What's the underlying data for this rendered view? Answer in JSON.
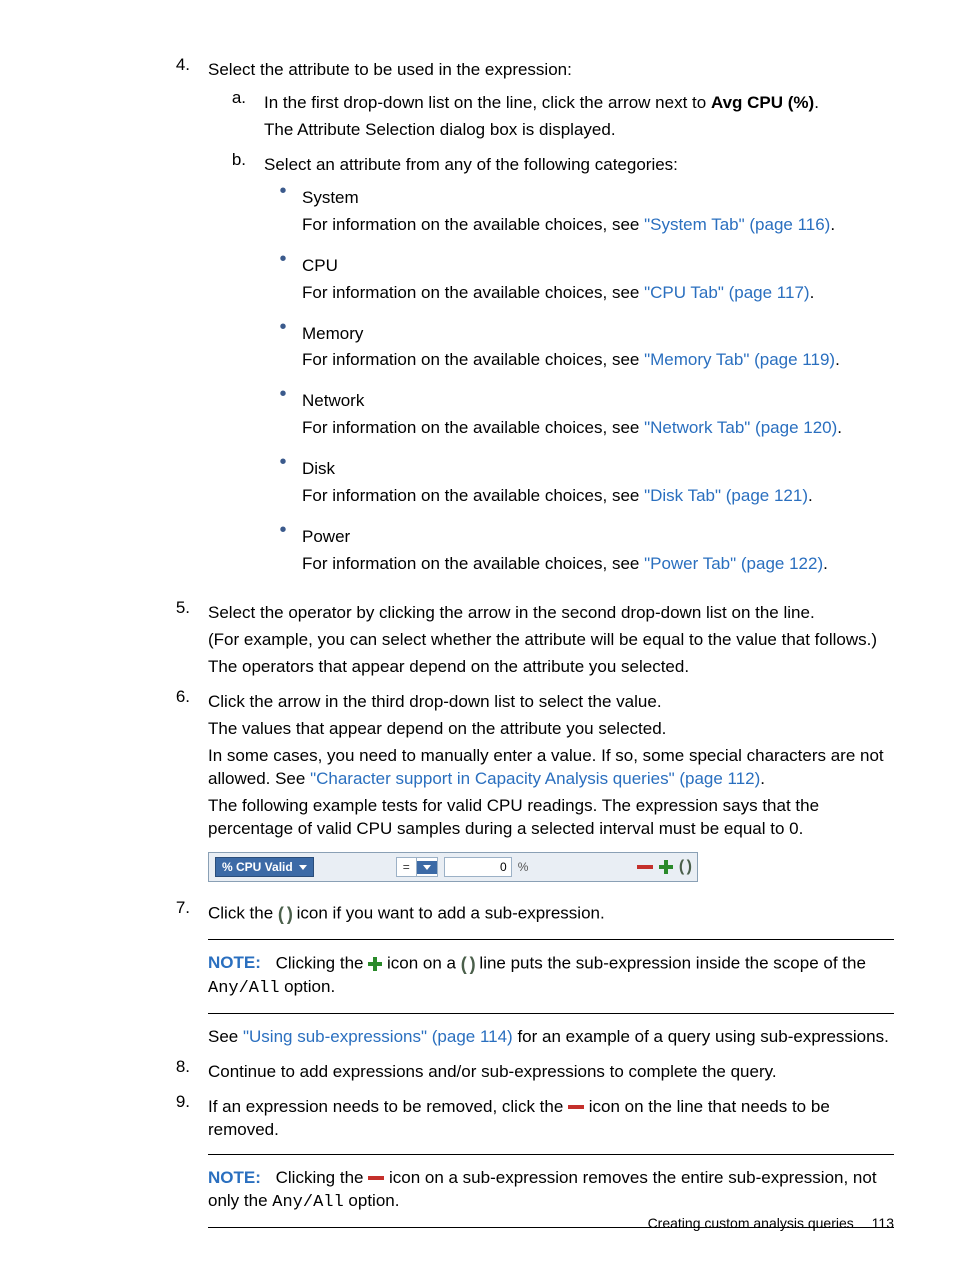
{
  "steps": {
    "s4": {
      "num": "4.",
      "lead": "Select the attribute to be used in the expression:",
      "a": {
        "num": "a.",
        "line1_pre": "In the first drop-down list on the line, click the arrow next to ",
        "line1_bold": "Avg CPU (%)",
        "line1_post": ".",
        "line2": "The Attribute Selection dialog box is displayed."
      },
      "b": {
        "num": "b.",
        "lead": "Select an attribute from any of the following categories:",
        "items": [
          {
            "name": "System",
            "info": "For information on the available choices, see ",
            "link": "\"System Tab\" (page 116)",
            "post": "."
          },
          {
            "name": "CPU",
            "info": "For information on the available choices, see ",
            "link": "\"CPU Tab\" (page 117)",
            "post": "."
          },
          {
            "name": "Memory",
            "info": "For information on the available choices, see ",
            "link": "\"Memory Tab\" (page 119)",
            "post": "."
          },
          {
            "name": "Network",
            "info": "For information on the available choices, see ",
            "link": "\"Network Tab\" (page 120)",
            "post": "."
          },
          {
            "name": "Disk",
            "info": "For information on the available choices, see ",
            "link": "\"Disk Tab\" (page 121)",
            "post": "."
          },
          {
            "name": "Power",
            "info": "For information on the available choices, see ",
            "link": "\"Power Tab\" (page 122)",
            "post": "."
          }
        ]
      }
    },
    "s5": {
      "num": "5.",
      "p1": "Select the operator by clicking the arrow in the second drop-down list on the line.",
      "p2": "(For example, you can select whether the attribute will be equal to the value that follows.)",
      "p3": "The operators that appear depend on the attribute you selected."
    },
    "s6": {
      "num": "6.",
      "p1": "Click the arrow in the third drop-down list to select the value.",
      "p2": "The values that appear depend on the attribute you selected.",
      "p3_pre": "In some cases, you need to manually enter a value. If so, some special characters are not allowed. See ",
      "p3_link": "\"Character support in Capacity Analysis queries\" (page 112)",
      "p3_post": ".",
      "p4": "The following example tests for valid CPU readings. The expression says that the percentage of valid CPU samples during a selected interval must be equal to 0."
    },
    "s7": {
      "num": "7.",
      "p1_pre": "Click the ",
      "p1_post": " icon if you want to add a sub-expression.",
      "note": {
        "label": "NOTE:",
        "pre": "Clicking the ",
        "mid": " icon on a ",
        "post": " line puts the sub-expression inside the scope of the ",
        "mono": "Any/All",
        "tail": " option."
      },
      "p2_pre": "See ",
      "p2_link": "\"Using sub-expressions\" (page 114)",
      "p2_post": " for an example of a query using sub-expressions."
    },
    "s8": {
      "num": "8.",
      "p1": "Continue to add expressions and/or sub-expressions to complete the query."
    },
    "s9": {
      "num": "9.",
      "p1_pre": "If an expression needs to be removed, click the ",
      "p1_post": " icon on the line that needs to be removed.",
      "note": {
        "label": "NOTE:",
        "pre": "Clicking the ",
        "post": " icon on a sub-expression removes the entire sub-expression, not only the ",
        "mono": "Any/All",
        "tail": " option."
      }
    }
  },
  "expr_bar": {
    "attribute": "% CPU Valid",
    "operator": "=",
    "value": "0",
    "unit": "%",
    "paren": "( )"
  },
  "icons": {
    "paren": "( )"
  },
  "footer": {
    "title": "Creating custom analysis queries",
    "page": "113"
  }
}
